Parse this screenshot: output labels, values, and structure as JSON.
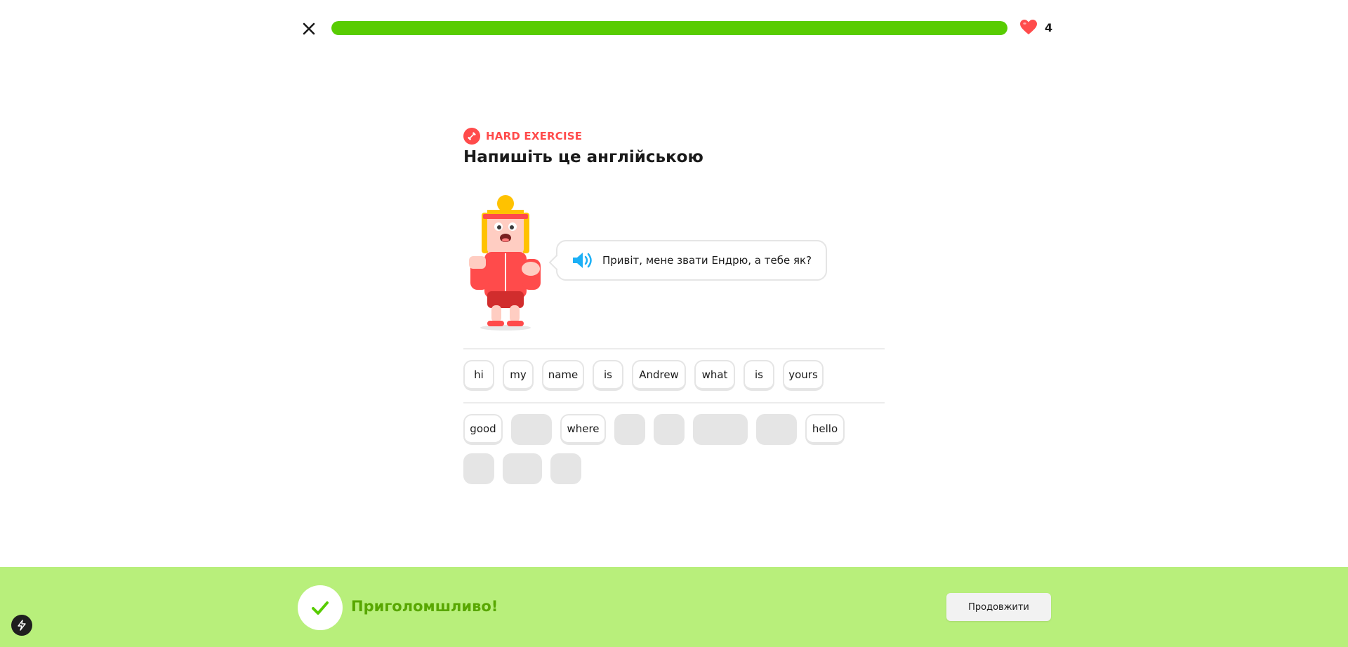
{
  "header": {
    "close_icon": "close-icon",
    "progress": 1.0,
    "hearts_icon": "heart-icon",
    "hearts_count": "4"
  },
  "challenge": {
    "badge_icon": "dumbbell-icon",
    "badge_label": "HARD EXERCISE",
    "title": "Напишіть це англійською",
    "prompt_text": "Привіт, мене звати Ендрю, а тебе як?",
    "speaker_icon": "speaker-icon"
  },
  "answer_tiles": [
    "hi",
    "my",
    "name",
    "is",
    "Andrew",
    "what",
    "is",
    "yours"
  ],
  "word_bank_row1": [
    {
      "label": "good"
    },
    {
      "label": ""
    },
    {
      "label": "where"
    },
    {
      "label": ""
    },
    {
      "label": ""
    },
    {
      "label": ""
    },
    {
      "label": ""
    },
    {
      "label": "hello"
    }
  ],
  "word_bank_row2": [
    {
      "label": ""
    },
    {
      "label": ""
    },
    {
      "label": ""
    }
  ],
  "footer": {
    "result_icon": "check-icon",
    "result_text": "Приголомшливо!",
    "continue_label": "Продовжити"
  },
  "colors": {
    "progress": "#58cc02",
    "heart": "#ff4b4b",
    "footer_bg": "#b8ef7b",
    "success_text": "#58a700"
  }
}
